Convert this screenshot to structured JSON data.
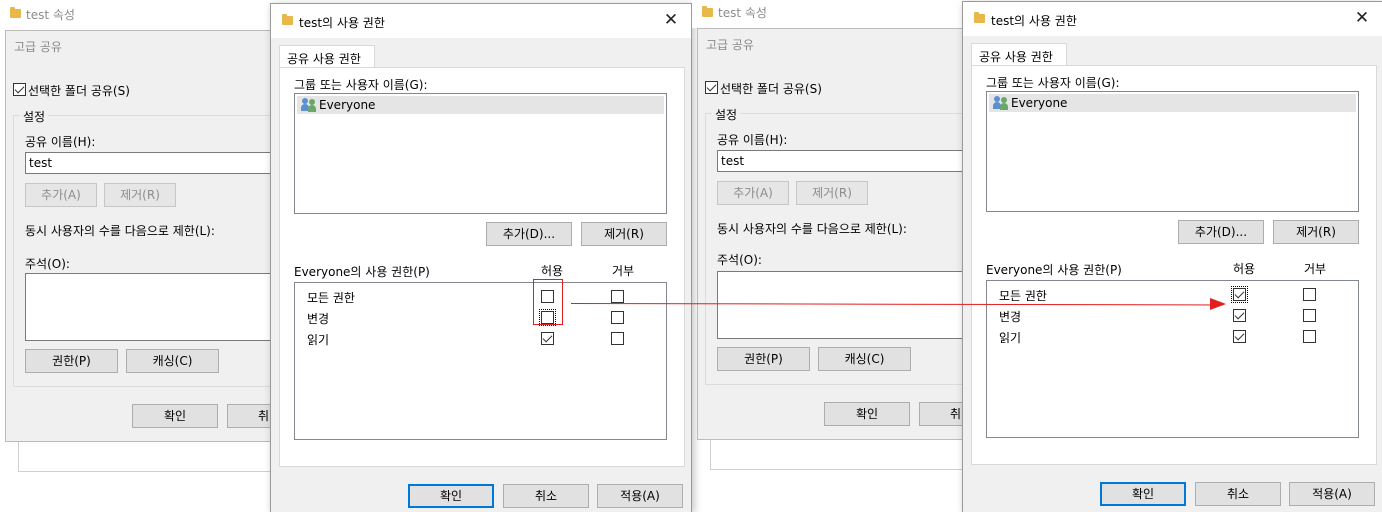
{
  "left": {
    "bg_props_title": "test 속성",
    "adv_share": {
      "title": "고급 공유",
      "share_checkbox_label": "선택한 폴더 공유(S)",
      "settings_group": "설정",
      "share_name_label": "공유 이름(H):",
      "share_name_value": "test",
      "add_btn": "추가(A)",
      "remove_btn": "제거(R)",
      "limit_label": "동시 사용자의 수를 다음으로 제한(L):",
      "comment_label": "주석(O):",
      "perm_btn": "권한(P)",
      "cache_btn": "캐싱(C)",
      "ok_btn": "확인",
      "cancel_partial": "취"
    },
    "perm_dialog": {
      "title": "test의 사용 권한",
      "tab": "공유 사용 권한",
      "group_label": "그룹 또는 사용자 이름(G):",
      "user": "Everyone",
      "add_btn": "추가(D)...",
      "remove_btn": "제거(R)",
      "perms_header": "Everyone의 사용 권한(P)",
      "allow_header": "허용",
      "deny_header": "거부",
      "rows": [
        {
          "name": "모든 권한",
          "allow": false,
          "deny": false
        },
        {
          "name": "변경",
          "allow": false,
          "deny": false
        },
        {
          "name": "읽기",
          "allow": true,
          "deny": false
        }
      ],
      "ok_btn": "확인",
      "cancel_btn": "취소",
      "apply_btn": "적용(A)"
    }
  },
  "right": {
    "bg_props_title": "test 속성",
    "adv_share": {
      "title": "고급 공유",
      "share_checkbox_label": "선택한 폴더 공유(S)",
      "settings_group": "설정",
      "share_name_label": "공유 이름(H):",
      "share_name_value": "test",
      "add_btn": "추가(A)",
      "remove_btn": "제거(R)",
      "limit_label": "동시 사용자의 수를 다음으로 제한(L):",
      "comment_label": "주석(O):",
      "perm_btn": "권한(P)",
      "cache_btn": "캐싱(C)",
      "ok_btn": "확인",
      "cancel_partial": "취"
    },
    "perm_dialog": {
      "title": "test의 사용 권한",
      "tab": "공유 사용 권한",
      "group_label": "그룹 또는 사용자 이름(G):",
      "user": "Everyone",
      "add_btn": "추가(D)...",
      "remove_btn": "제거(R)",
      "perms_header": "Everyone의 사용 권한(P)",
      "allow_header": "허용",
      "deny_header": "거부",
      "rows": [
        {
          "name": "모든 권한",
          "allow": true,
          "deny": false
        },
        {
          "name": "변경",
          "allow": true,
          "deny": false
        },
        {
          "name": "읽기",
          "allow": true,
          "deny": false
        }
      ],
      "ok_btn": "확인",
      "cancel_btn": "취소",
      "apply_btn": "적용(A)"
    }
  },
  "colors": {
    "annotation": "#e31e1e",
    "dialog_bg": "#f0f0f0",
    "default_button_border": "#0078d7"
  }
}
